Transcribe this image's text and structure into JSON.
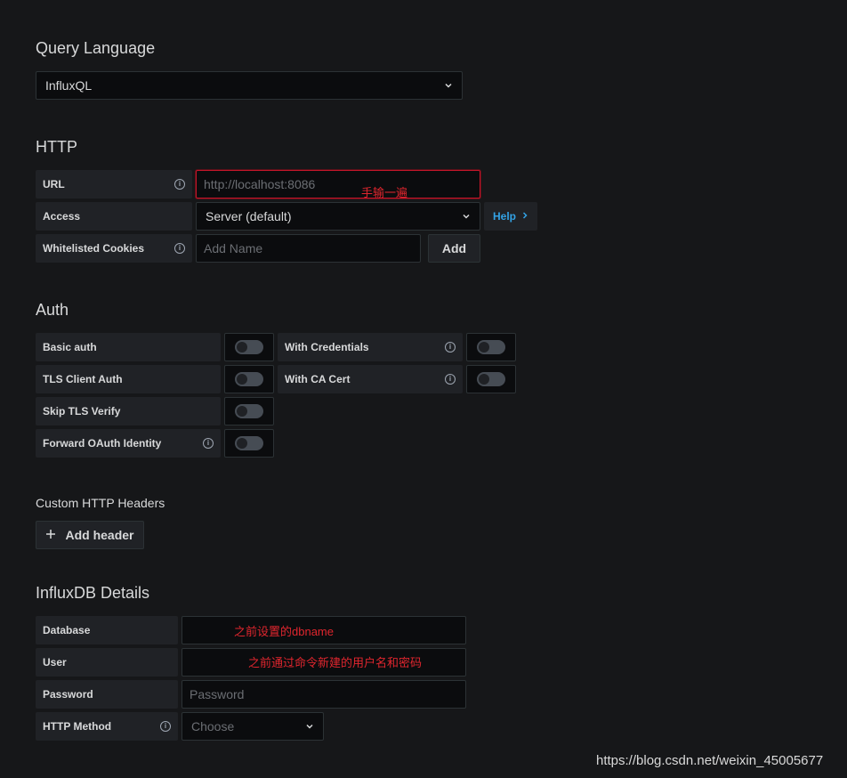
{
  "query_language": {
    "title": "Query Language",
    "selected": "InfluxQL"
  },
  "http": {
    "title": "HTTP",
    "url_label": "URL",
    "url_placeholder": "http://localhost:8086",
    "url_annotation": "手输一遍",
    "access_label": "Access",
    "access_selected": "Server (default)",
    "help_label": "Help",
    "cookies_label": "Whitelisted Cookies",
    "cookies_placeholder": "Add Name",
    "add_label": "Add"
  },
  "auth": {
    "title": "Auth",
    "basic_auth": "Basic auth",
    "with_credentials": "With Credentials",
    "tls_client_auth": "TLS Client Auth",
    "with_ca_cert": "With CA Cert",
    "skip_tls_verify": "Skip TLS Verify",
    "forward_oauth": "Forward OAuth Identity",
    "toggles": {
      "basic_auth": false,
      "with_credentials": false,
      "tls_client_auth": false,
      "with_ca_cert": false,
      "skip_tls_verify": false,
      "forward_oauth": false
    }
  },
  "custom_headers": {
    "title": "Custom HTTP Headers",
    "add_header_label": "Add header"
  },
  "influxdb": {
    "title": "InfluxDB Details",
    "database_label": "Database",
    "database_annotation": "之前设置的dbname",
    "user_label": "User",
    "user_annotation": "之前通过命令新建的用户名和密码",
    "password_label": "Password",
    "password_placeholder": "Password",
    "http_method_label": "HTTP Method",
    "http_method_placeholder": "Choose"
  },
  "watermark": "https://blog.csdn.net/weixin_45005677",
  "colors": {
    "background": "#161719",
    "annotation": "#e0262e",
    "link": "#33a2e5",
    "error_border": "#c4162a"
  }
}
